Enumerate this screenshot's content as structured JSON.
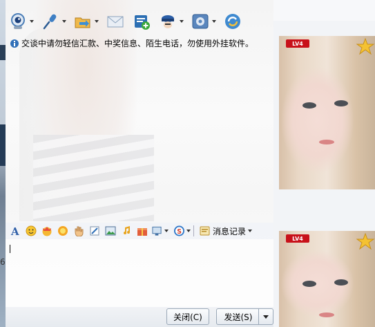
{
  "toolbar": {
    "items": [
      {
        "icon": "webcam-icon",
        "has_menu": true
      },
      {
        "icon": "microphone-icon",
        "has_menu": true
      },
      {
        "icon": "send-file-icon",
        "has_menu": true
      },
      {
        "icon": "email-icon",
        "has_menu": false
      },
      {
        "icon": "add-contact-icon",
        "has_menu": false
      },
      {
        "icon": "apps-icon",
        "has_menu": true
      },
      {
        "icon": "settings-icon",
        "has_menu": true
      },
      {
        "icon": "refresh-icon",
        "has_menu": false
      }
    ]
  },
  "notice": {
    "text": "交谈中请勿轻信汇款、中奖信息、陌生电话，勿使用外挂软件。"
  },
  "format_bar": {
    "message_history_label": "消息记录"
  },
  "buttons": {
    "close_label": "关闭(C)",
    "send_label": "发送(S)"
  },
  "profiles": [
    {
      "level_badge": "LV4"
    },
    {
      "level_badge": "LV4"
    }
  ],
  "left_fragment_text": "6",
  "colors": {
    "level_badge_red": "#c8111a",
    "accent_blue": "#2f6fb8"
  }
}
